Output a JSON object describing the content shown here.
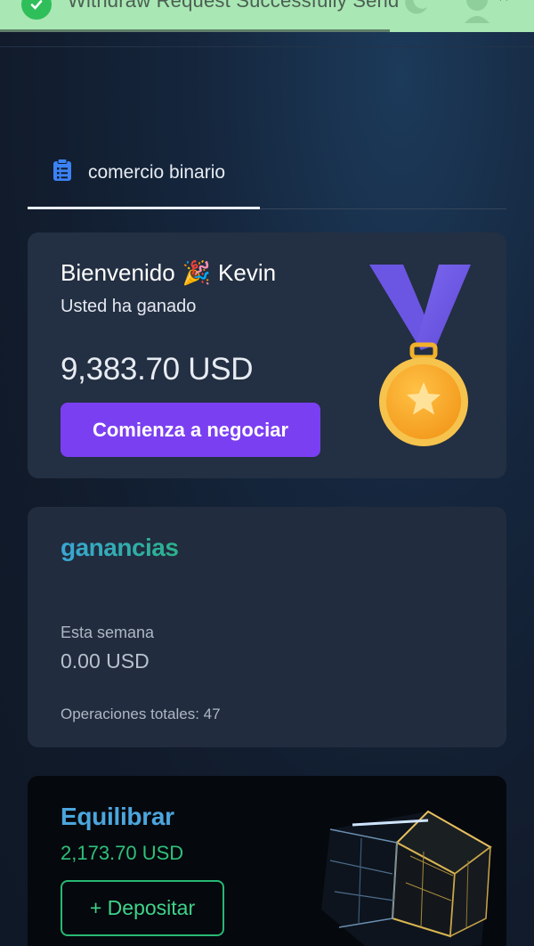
{
  "toast": {
    "message": "Withdraw Request Successfully Send",
    "progress_fraction": 0.73,
    "close_symbol": "×"
  },
  "tabs": [
    {
      "label": "comercio binario",
      "active": true,
      "icon": "clipboard-icon"
    }
  ],
  "welcome": {
    "greeting": "Bienvenido",
    "emoji": "🎉",
    "name": "Kevin",
    "subtitle": "Usted ha ganado",
    "amount": "9,383.70 USD",
    "cta_label": "Comienza a negociar",
    "badge_icon": "medal-icon"
  },
  "earnings": {
    "title": "ganancias",
    "week_label": "Esta semana",
    "week_value": "0.00 USD",
    "total_ops_label": "Operaciones totales: 47"
  },
  "balance": {
    "title": "Equilibrar",
    "amount": "2,173.70  USD",
    "deposit_label": "+ Depositar"
  },
  "colors": {
    "accent_purple": "#7b3ff2",
    "toast_green": "#a9e7b4",
    "success_green": "#2fc07a",
    "balance_blue": "#4ba6dd"
  }
}
